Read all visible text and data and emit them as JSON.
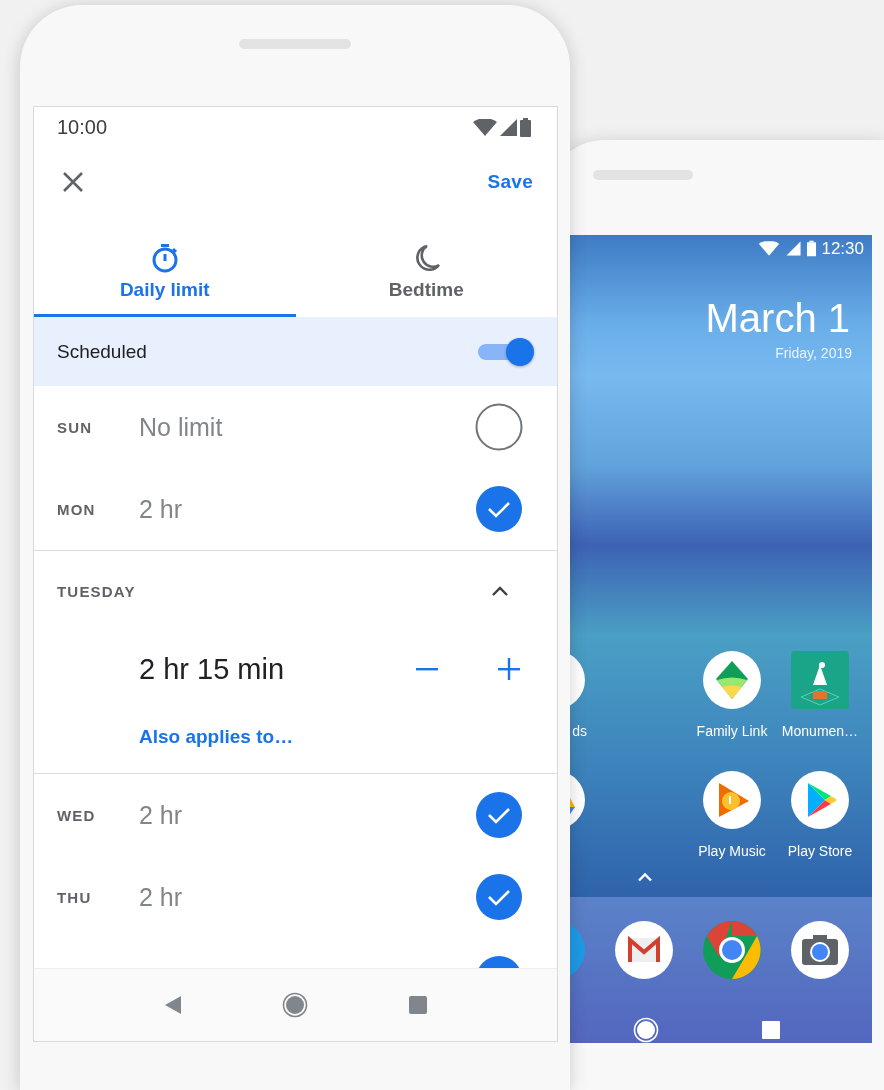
{
  "limits_screen": {
    "status_bar": {
      "time": "10:00"
    },
    "app_bar": {
      "action": "Save"
    },
    "tabs": [
      {
        "label": "Daily limit",
        "kind": "timer",
        "selected": true
      },
      {
        "label": "Bedtime",
        "kind": "moon",
        "selected": false
      }
    ],
    "schedule": {
      "label": "Scheduled",
      "on": true
    },
    "days": [
      {
        "kind": "day",
        "day": "SUN",
        "limit": "No limit",
        "checked": false
      },
      {
        "kind": "day",
        "day": "MON",
        "limit": "2 hr",
        "checked": true
      },
      {
        "kind": "expanded",
        "day": "TUESDAY",
        "limit": "2 hr 15 min",
        "link": "Also applies to…"
      },
      {
        "kind": "day",
        "day": "WED",
        "limit": "2 hr",
        "checked": true
      },
      {
        "kind": "day",
        "day": "THU",
        "limit": "2 hr",
        "checked": true
      },
      {
        "kind": "clipped",
        "checked": true
      }
    ]
  },
  "home_screen": {
    "status_bar": {
      "time": "12:30"
    },
    "date": "March 1",
    "subdate": "Friday, 2019",
    "apps": [
      {
        "kind": "partial-red",
        "label": "ds"
      },
      {
        "kind": "family",
        "label": "Family Link"
      },
      {
        "kind": "monument",
        "label": "Monumen…"
      },
      {
        "kind": "partial-drive"
      },
      {
        "kind": "music",
        "label": "Play Music"
      },
      {
        "kind": "store",
        "label": "Play Store"
      }
    ],
    "dock": [
      {
        "kind": "partial-blue"
      },
      {
        "kind": "gmail"
      },
      {
        "kind": "chrome"
      },
      {
        "kind": "camera"
      }
    ]
  }
}
